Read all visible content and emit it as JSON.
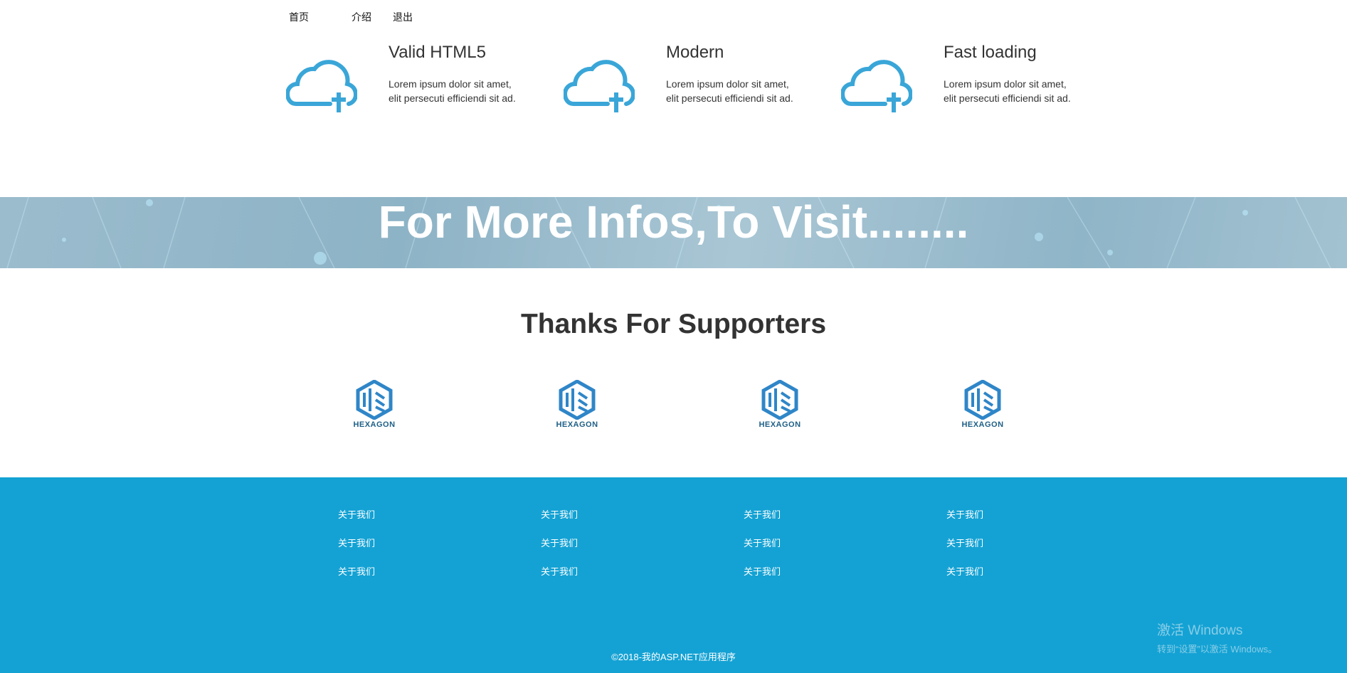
{
  "nav": {
    "items": [
      "首页",
      "介绍",
      "退出"
    ]
  },
  "features": [
    {
      "title": "Valid HTML5",
      "line1": "Lorem ipsum dolor sit amet,",
      "line2": "elit persecuti efficiendi sit ad.",
      "icon": "cloud-plus-icon"
    },
    {
      "title": "Modern",
      "line1": "Lorem ipsum dolor sit amet,",
      "line2": "elit persecuti efficiendi sit ad.",
      "icon": "cloud-plus-icon"
    },
    {
      "title": "Fast loading",
      "line1": "Lorem ipsum dolor sit amet,",
      "line2": "elit persecuti efficiendi sit ad.",
      "icon": "cloud-plus-icon"
    }
  ],
  "banner": {
    "text": "For More Infos,To Visit........"
  },
  "supporters": {
    "title": "Thanks For Supporters",
    "logos": [
      "HEXAGON",
      "HEXAGON",
      "HEXAGON",
      "HEXAGON"
    ]
  },
  "footer": {
    "links": [
      [
        "关于我们",
        "关于我们",
        "关于我们"
      ],
      [
        "关于我们",
        "关于我们",
        "关于我们"
      ],
      [
        "关于我们",
        "关于我们",
        "关于我们"
      ],
      [
        "关于我们",
        "关于我们",
        "关于我们"
      ]
    ],
    "copyright": "©2018-我的ASP.NET应用程序"
  },
  "watermark": {
    "line1": "激活 Windows",
    "line2": "转到“设置”以激活 Windows。"
  },
  "colors": {
    "accent": "#14a2d4",
    "icon": "#3aa6d8",
    "logo": "#2f86c8"
  }
}
